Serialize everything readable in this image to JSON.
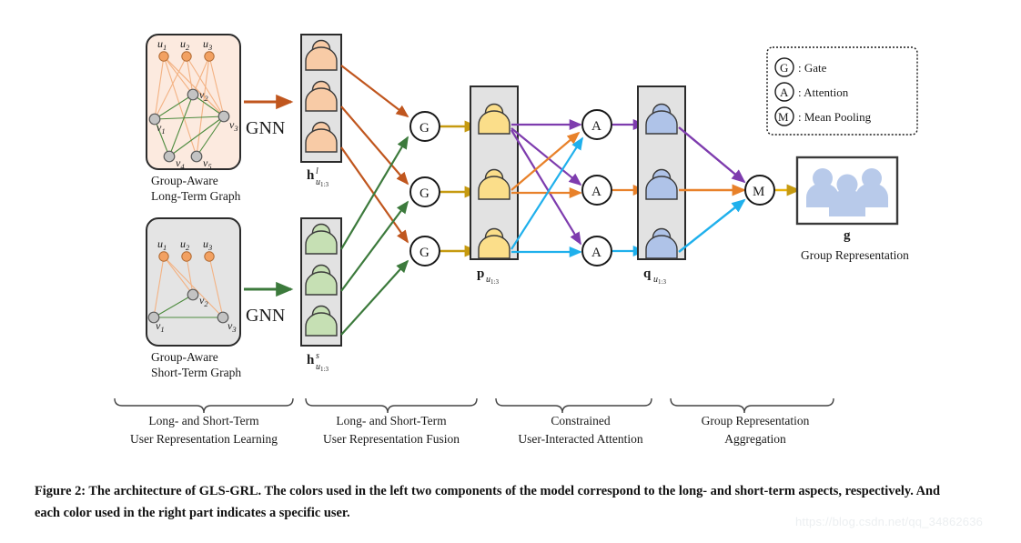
{
  "figure": {
    "caption_line1": "Figure 2: The architecture of GLS-GRL. The colors used in the left two components of the model correspond to the long- and",
    "caption_line2": "short-term aspects, respectively. And each color used in the right part indicates a specific user.",
    "watermark": "https://blog.csdn.net/qq_34862636"
  },
  "colors": {
    "long_term_accent": "#C0561E",
    "short_term_accent": "#3C7A3C",
    "gate_arrow": "#C69A10",
    "user1_purple": "#7E3CAE",
    "user2_orange": "#E8812A",
    "user3_cyan": "#1FB0EC",
    "user_peach_fill": "#F8CBA6",
    "user_green_fill": "#C6E0B4",
    "user_yellow_fill": "#FBDE8A",
    "user_blue_fill": "#AFC3E8",
    "panel_gray": "#E2E2E2",
    "long_graph_bg": "#FCEADF",
    "short_graph_bg": "#E4E4E4",
    "node_gray": "#BFBFBF"
  },
  "graphs": {
    "long_term": {
      "caption_line1": "Group-Aware",
      "caption_line2": "Long-Term Graph",
      "user_nodes": [
        "u",
        "u",
        "u"
      ],
      "user_node_labels": [
        "u1",
        "u2",
        "u3"
      ],
      "item_node_labels": [
        "v1",
        "v2",
        "v3",
        "v4",
        "v5"
      ]
    },
    "short_term": {
      "caption_line1": "Group-Aware",
      "caption_line2": "Short-Term Graph",
      "user_node_labels": [
        "u1",
        "u2",
        "u3"
      ],
      "item_node_labels": [
        "v1",
        "v2",
        "v3"
      ]
    }
  },
  "operators": {
    "gnn_long": "GNN",
    "gnn_short": "GNN",
    "gate_glyph": "G",
    "attention_glyph": "A",
    "mean_glyph": "M"
  },
  "panel_labels": {
    "h_long": {
      "base": "h",
      "sup": "l",
      "sub": "u1:3"
    },
    "h_short": {
      "base": "h",
      "sup": "s",
      "sub": "u1:3"
    },
    "p": {
      "base": "p",
      "sub": "u1:3"
    },
    "q": {
      "base": "q",
      "sub": "u1:3"
    },
    "g": "g",
    "group_representation": "Group Representation"
  },
  "legend": {
    "items": [
      {
        "glyph": "G",
        "label": ": Gate"
      },
      {
        "glyph": "A",
        "label": ": Attention"
      },
      {
        "glyph": "M",
        "label": ": Mean Pooling"
      }
    ]
  },
  "stages": [
    {
      "line1": "Long- and Short-Term",
      "line2": "User Representation Learning"
    },
    {
      "line1": "Long- and Short-Term",
      "line2": "User Representation Fusion"
    },
    {
      "line1": "Constrained",
      "line2": "User-Interacted Attention"
    },
    {
      "line1": "Group Representation",
      "line2": "Aggregation"
    }
  ]
}
